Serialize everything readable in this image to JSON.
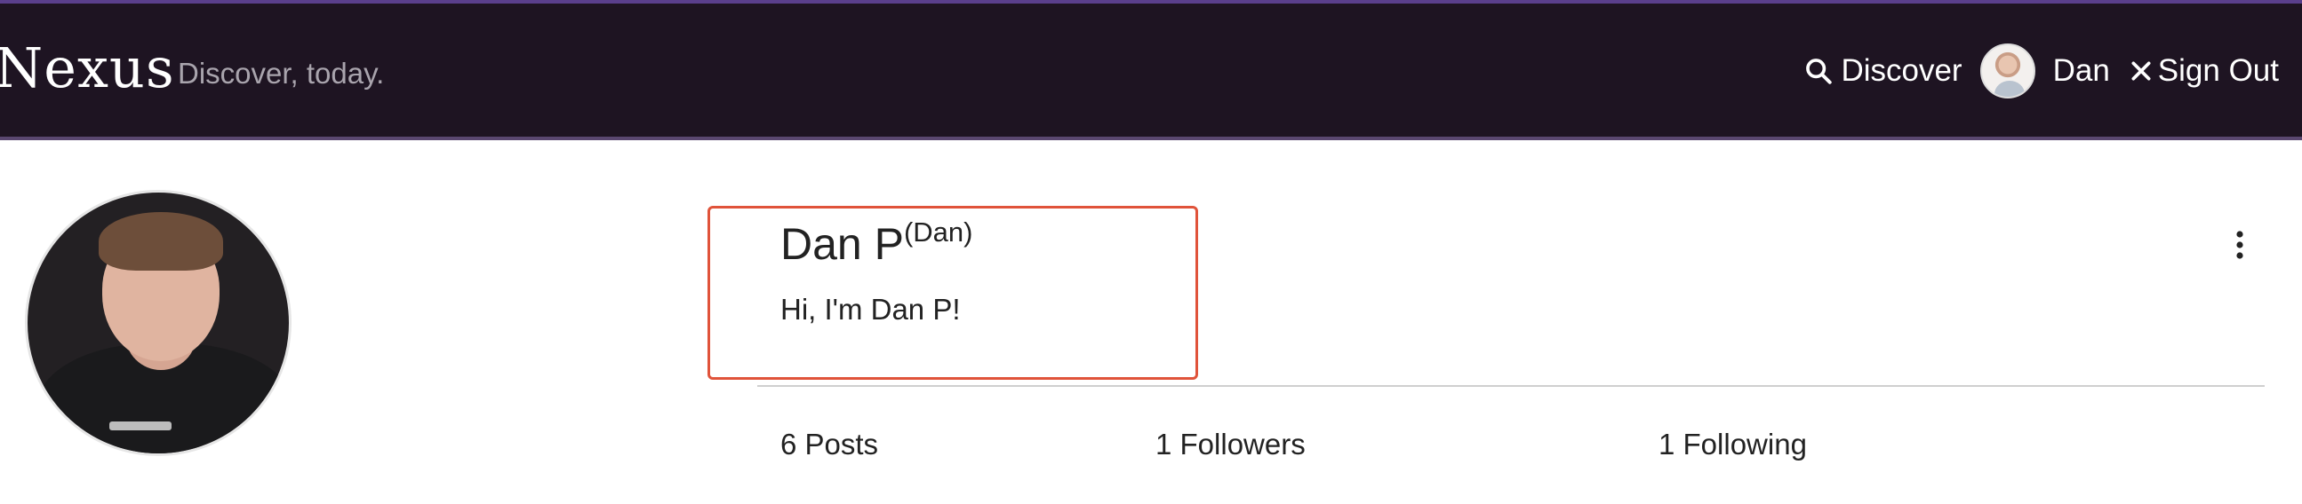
{
  "header": {
    "brand": "Nexus",
    "tagline": "Discover, today.",
    "discover_label": "Discover",
    "user_label": "Dan",
    "sign_out_label": "Sign Out"
  },
  "profile": {
    "display_name": "Dan P",
    "username": "(Dan)",
    "bio": "Hi, I'm Dan P!",
    "stats": {
      "posts": "6 Posts",
      "followers": "1 Followers",
      "following": "1 Following"
    }
  },
  "colors": {
    "header_bg": "#1e1422",
    "highlight_border": "#e0533a"
  },
  "icons": {
    "discover": "search-icon",
    "sign_out": "close-icon",
    "menu": "more-vertical-icon"
  }
}
